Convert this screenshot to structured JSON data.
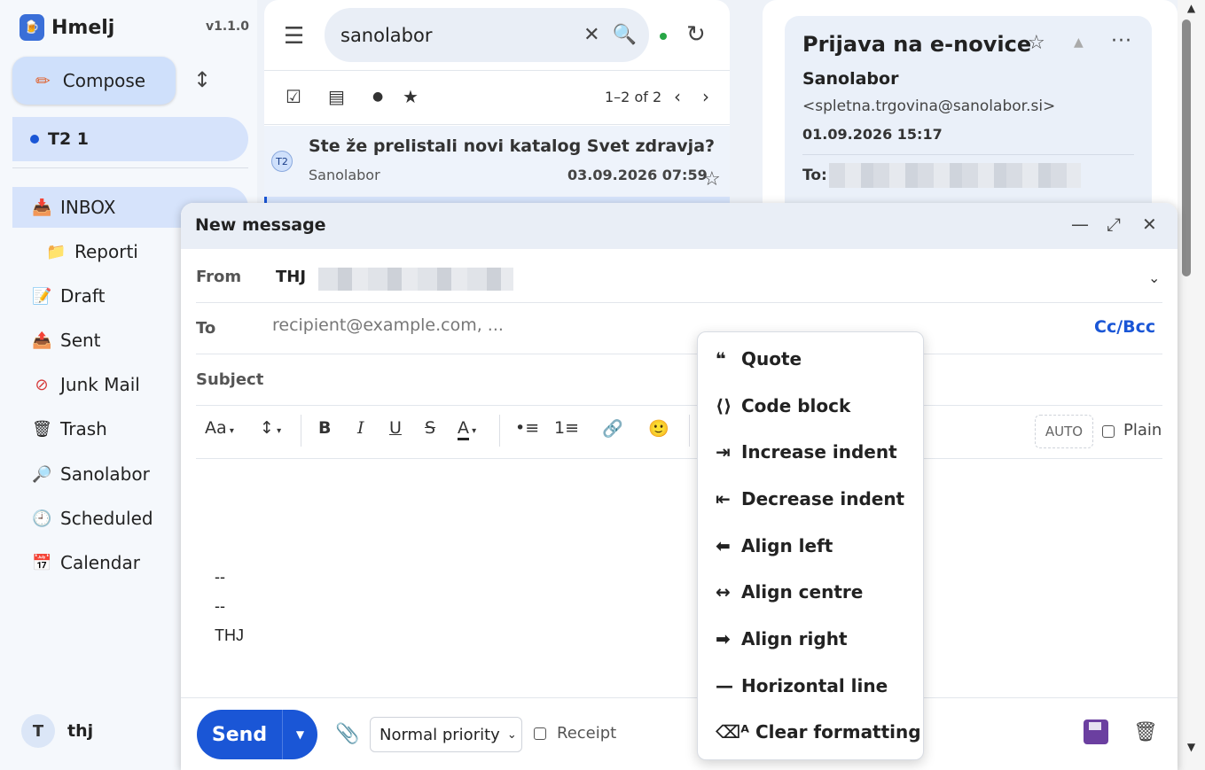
{
  "app": {
    "name": "Hmelj",
    "version": "v1.1.0"
  },
  "sidebar": {
    "compose_label": "Compose",
    "account": {
      "label": "T2  1"
    },
    "folders": [
      {
        "icon": "inbox-icon",
        "label": "INBOX"
      },
      {
        "icon": "folder-icon",
        "label": "Reporti"
      },
      {
        "icon": "draft-icon",
        "label": "Draft"
      },
      {
        "icon": "sent-icon",
        "label": "Sent"
      },
      {
        "icon": "junk-icon",
        "label": "Junk Mail"
      },
      {
        "icon": "trash-icon",
        "label": "Trash"
      },
      {
        "icon": "magnifier-icon",
        "label": "Sanolabor"
      },
      {
        "icon": "clock-icon",
        "label": "Scheduled"
      },
      {
        "icon": "calendar-icon",
        "label": "Calendar"
      }
    ],
    "user": {
      "initial": "T",
      "name": "thj"
    }
  },
  "list": {
    "search_value": "sanolabor",
    "paging": "1–2 of 2",
    "messages": [
      {
        "avatar": "T2",
        "subject": "Ste že prelistali novi katalog Svet zdravja?",
        "from": "Sanolabor",
        "date": "03.09.2026 07:59"
      }
    ]
  },
  "reader": {
    "title": "Prijava na e-novice",
    "sender": "Sanolabor",
    "email": "<spletna.trgovina@sanolabor.si>",
    "date": "01.09.2026 15:17",
    "to_label": "To:"
  },
  "compose": {
    "title": "New message",
    "from_label": "From",
    "from_value": "THJ",
    "to_label": "To",
    "to_placeholder": "recipient@example.com, ...",
    "ccbcc": "Cc/Bcc",
    "subject_label": "Subject",
    "toolbar": {
      "font": "Aa",
      "size": "↕",
      "bold": "B",
      "italic": "I",
      "underline": "U",
      "strike": "S",
      "color": "A",
      "bullets": "•≡",
      "numbers": "1≡",
      "auto": "AUTO",
      "plain": "Plain"
    },
    "body_lines": [
      "--",
      "--",
      "THJ"
    ],
    "send_label": "Send",
    "priority": "Normal priority",
    "receipt_label": "Receipt"
  },
  "format_menu": [
    {
      "glyph": "❝",
      "label": "Quote"
    },
    {
      "glyph": "⟨⟩",
      "label": "Code block"
    },
    {
      "glyph": "⇥",
      "label": "Increase indent"
    },
    {
      "glyph": "⇤",
      "label": "Decrease indent"
    },
    {
      "glyph": "⬅",
      "label": "Align left"
    },
    {
      "glyph": "↔",
      "label": "Align centre"
    },
    {
      "glyph": "➡",
      "label": "Align right"
    },
    {
      "glyph": "—",
      "label": "Horizontal line"
    },
    {
      "glyph": "⌫ᴬ",
      "label": "Clear formatting"
    }
  ],
  "colors": {
    "accent": "#1a56d6",
    "selected": "#d6e3fb"
  }
}
